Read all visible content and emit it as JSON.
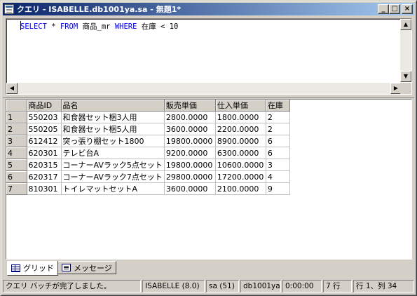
{
  "window": {
    "title": "クエリ - ISABELLE.db1001ya.sa - 無題1*",
    "minimize": "_",
    "maximize": "□",
    "close": "×"
  },
  "editor": {
    "sql_parts": [
      {
        "text": "SELECT",
        "kind": "kw"
      },
      {
        "text": " * ",
        "kind": "tx"
      },
      {
        "text": "FROM",
        "kind": "kw"
      },
      {
        "text": " 商品_mr ",
        "kind": "tx"
      },
      {
        "text": "WHERE",
        "kind": "kw"
      },
      {
        "text": " 在庫 < 10",
        "kind": "tx"
      }
    ]
  },
  "grid": {
    "columns": [
      "商品ID",
      "品名",
      "販売単価",
      "仕入単価",
      "在庫"
    ],
    "rows": [
      {
        "n": "1",
        "cells": [
          "550203",
          "和食器セット梱3人用",
          "2800.0000",
          "1800.0000",
          "2"
        ]
      },
      {
        "n": "2",
        "cells": [
          "550205",
          "和食器セット梱5人用",
          "3600.0000",
          "2200.0000",
          "2"
        ]
      },
      {
        "n": "3",
        "cells": [
          "612412",
          "突っ張り棚セット1800",
          "19800.0000",
          "8900.0000",
          "6"
        ]
      },
      {
        "n": "4",
        "cells": [
          "620301",
          "テレビ台A",
          "9200.0000",
          "6300.0000",
          "6"
        ]
      },
      {
        "n": "5",
        "cells": [
          "620315",
          "コーナーAVラック5点セット",
          "19800.0000",
          "10600.0000",
          "3"
        ]
      },
      {
        "n": "6",
        "cells": [
          "620317",
          "コーナーAVラック7点セット",
          "29800.0000",
          "17200.0000",
          "4"
        ]
      },
      {
        "n": "7",
        "cells": [
          "810301",
          "トイレマットセットA",
          "3600.0000",
          "2100.0000",
          "9"
        ]
      }
    ]
  },
  "tabs": [
    {
      "label": "グリッド",
      "icon": "grid-icon",
      "active": true
    },
    {
      "label": "メッセージ",
      "icon": "message-icon",
      "active": false
    }
  ],
  "status": {
    "message": "クエリ バッチが完了しました。",
    "server": "ISABELLE (8.0)",
    "user": "sa (51)",
    "database": "db1001ya",
    "elapsed": "0:00:00",
    "rows": "7 行",
    "position": "行 1、列 34"
  }
}
